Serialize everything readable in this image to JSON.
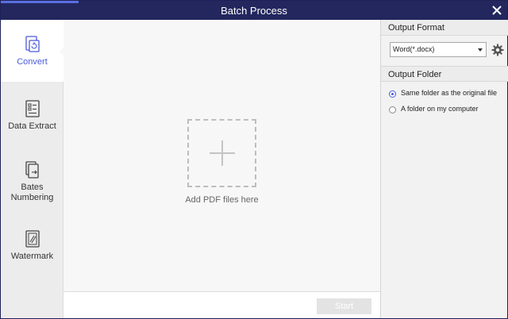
{
  "window": {
    "title": "Batch Process"
  },
  "sidebar": {
    "items": [
      {
        "label": "Convert",
        "icon": "convert-icon",
        "active": true
      },
      {
        "label": "Data Extract",
        "icon": "data-extract-icon",
        "active": false
      },
      {
        "label": "Bates\nNumbering",
        "icon": "bates-numbering-icon",
        "active": false
      },
      {
        "label": "Watermark",
        "icon": "watermark-icon",
        "active": false
      }
    ]
  },
  "main": {
    "drop_label": "Add PDF files here",
    "start_label": "Start"
  },
  "right_panel": {
    "output_format_title": "Output Format",
    "format_value": "Word(*.docx)",
    "output_folder_title": "Output Folder",
    "folder_options": [
      {
        "label": "Same folder as the original file",
        "checked": true
      },
      {
        "label": "A folder on my computer",
        "checked": false
      }
    ]
  },
  "colors": {
    "titlebar": "#23275e",
    "accent": "#4a5bd6",
    "sidebar_bg": "#ececec",
    "main_bg": "#f7f7f7"
  }
}
